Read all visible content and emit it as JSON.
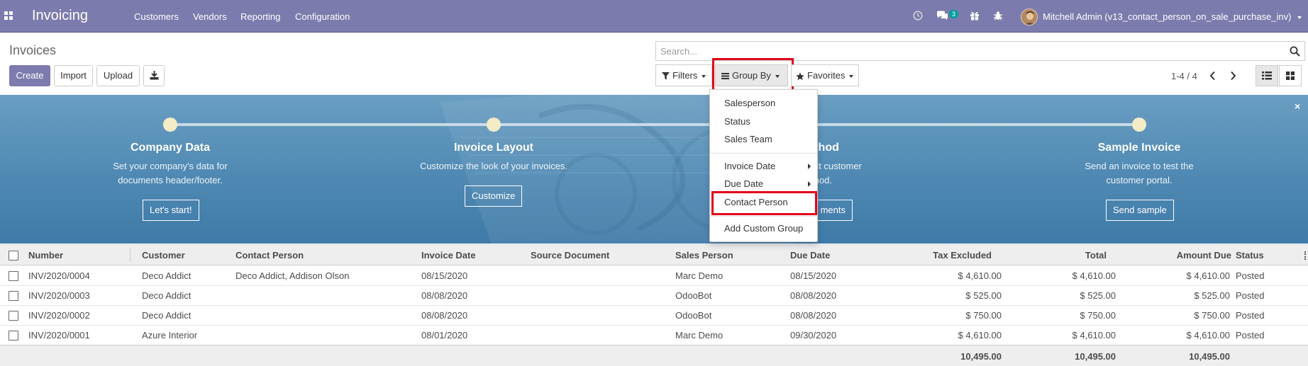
{
  "navbar": {
    "brand": "Invoicing",
    "menus": [
      "Customers",
      "Vendors",
      "Reporting",
      "Configuration"
    ],
    "icons": [
      "apps-icon",
      "clock-icon",
      "chat-icon",
      "gift-icon",
      "bug-icon"
    ],
    "message_count": "3",
    "user": "Mitchell Admin (v13_contact_person_on_sale_purchase_inv)",
    "color": "#7c7bad"
  },
  "control": {
    "title": "Invoices",
    "create": "Create",
    "import": "Import",
    "upload": "Upload",
    "search_placeholder": "Search...",
    "filters": "Filters",
    "group_by": "Group By",
    "favorites": "Favorites",
    "pager": "1-4 / 4"
  },
  "banner": {
    "steps": [
      {
        "title": "Company Data",
        "desc1": "Set your company's data for",
        "desc2": "documents header/footer.",
        "button": "Let's start!"
      },
      {
        "title": "Invoice Layout",
        "desc1": "Customize the look of your invoices.",
        "desc2": "",
        "button": "Customize"
      },
      {
        "title": "Method",
        "desc1": "efault customer",
        "desc2": "method.",
        "button": "ments"
      },
      {
        "title": "Sample Invoice",
        "desc1": "Send an invoice to test the",
        "desc2": "customer portal.",
        "button": "Send sample"
      }
    ],
    "close": "×"
  },
  "dropdown": {
    "items1": [
      "Salesperson",
      "Status",
      "Sales Team"
    ],
    "items2": [
      "Invoice Date",
      "Due Date"
    ],
    "contact_person": "Contact Person",
    "custom_group": "Add Custom Group"
  },
  "table": {
    "headers": [
      "Number",
      "Customer",
      "Contact Person",
      "Invoice Date",
      "Source Document",
      "Sales Person",
      "Due Date",
      "Tax Excluded",
      "Total",
      "Amount Due",
      "Status"
    ],
    "rows": [
      {
        "number": "INV/2020/0004",
        "customer": "Deco Addict",
        "contact": "Deco Addict, Addison Olson",
        "invoice_date": "08/15/2020",
        "source": "",
        "sales_person": "Marc Demo",
        "due_date": "08/15/2020",
        "tax_excluded": "$ 4,610.00",
        "total": "$ 4,610.00",
        "amount_due": "$ 4,610.00",
        "status": "Posted"
      },
      {
        "number": "INV/2020/0003",
        "customer": "Deco Addict",
        "contact": "",
        "invoice_date": "08/08/2020",
        "source": "",
        "sales_person": "OdooBot",
        "due_date": "08/08/2020",
        "tax_excluded": "$ 525.00",
        "total": "$ 525.00",
        "amount_due": "$ 525.00",
        "status": "Posted"
      },
      {
        "number": "INV/2020/0002",
        "customer": "Deco Addict",
        "contact": "",
        "invoice_date": "08/08/2020",
        "source": "",
        "sales_person": "OdooBot",
        "due_date": "08/08/2020",
        "tax_excluded": "$ 750.00",
        "total": "$ 750.00",
        "amount_due": "$ 750.00",
        "status": "Posted"
      },
      {
        "number": "INV/2020/0001",
        "customer": "Azure Interior",
        "contact": "",
        "invoice_date": "08/01/2020",
        "source": "",
        "sales_person": "Marc Demo",
        "due_date": "09/30/2020",
        "tax_excluded": "$ 4,610.00",
        "total": "$ 4,610.00",
        "amount_due": "$ 4,610.00",
        "status": "Posted"
      }
    ],
    "totals": {
      "tax_excluded": "10,495.00",
      "total": "10,495.00",
      "amount_due": "10,495.00"
    }
  }
}
